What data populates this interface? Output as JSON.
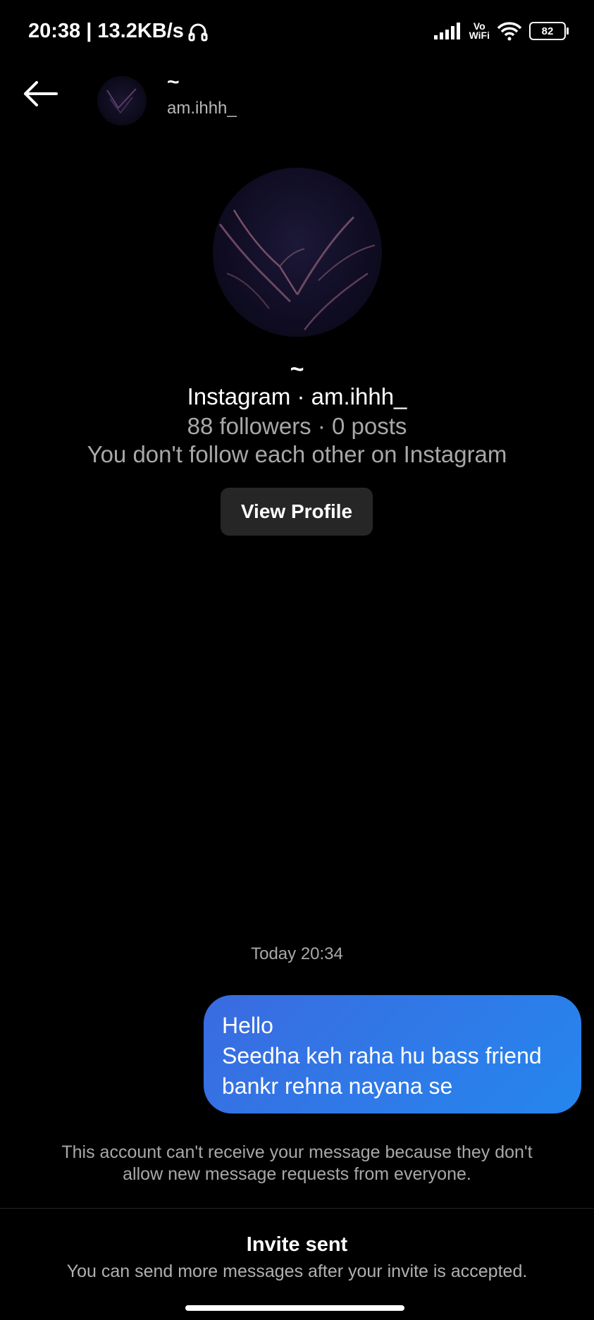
{
  "status_bar": {
    "time_speed": "20:38 | 13.2KB/s",
    "volte_top": "Vo",
    "volte_bottom": "WiFi",
    "battery": "82"
  },
  "header": {
    "name": "~",
    "handle": "am.ihhh_"
  },
  "profile": {
    "name": "~",
    "line1": "Instagram · am.ihhh_",
    "line2": "88 followers · 0 posts",
    "line3": "You don't follow each other on Instagram",
    "view_profile_label": "View Profile"
  },
  "chat": {
    "timestamp": "Today 20:34",
    "message_lines": [
      "Hello",
      "Seedha keh raha hu bass friend",
      "bankr rehna nayana se"
    ]
  },
  "footer": {
    "notice_line1": "This account can't receive your message because they don't",
    "notice_line2": "allow new message requests from everyone.",
    "invite_title": "Invite sent",
    "invite_sub": "You can send more messages after your invite is accepted."
  },
  "icons": [
    "headphones-icon",
    "signal-icon",
    "wifi-icon",
    "battery-icon",
    "back-arrow-icon"
  ]
}
